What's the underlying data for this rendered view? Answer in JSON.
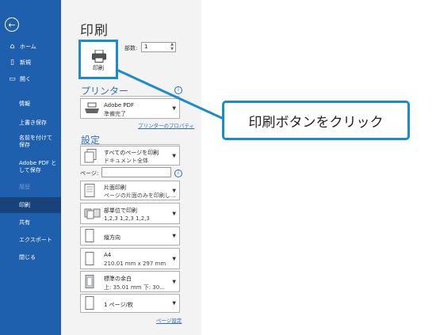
{
  "sidebar": {
    "back_symbol": "←",
    "items": [
      {
        "label": "ホーム",
        "icon": "home-icon"
      },
      {
        "label": "新規",
        "icon": "new-document-icon"
      },
      {
        "label": "開く",
        "icon": "open-folder-icon"
      },
      {
        "label": "情報"
      },
      {
        "label": "上書き保存"
      },
      {
        "label": "名前を付けて保存"
      },
      {
        "label": "Adobe PDF として保存"
      },
      {
        "label": "履歴"
      },
      {
        "label": "印刷"
      },
      {
        "label": "共有"
      },
      {
        "label": "エクスポート"
      },
      {
        "label": "閉じる"
      }
    ]
  },
  "main": {
    "title": "印刷",
    "print_button_label": "印刷",
    "copies_label": "部数:",
    "copies_value": "1",
    "printer_section": {
      "heading": "プリンター",
      "name": "Adobe PDF",
      "status": "準備完了",
      "properties_link": "プリンターのプロパティ"
    },
    "settings_section": {
      "heading": "設定",
      "pages_label": "ページ:",
      "page_setup_link": "ページ設定",
      "dropdowns": [
        {
          "line1": "すべてのページを印刷",
          "line2": "ドキュメント全体"
        },
        {
          "line1": "片面印刷",
          "line2": "ページの片面のみを印刷し..."
        },
        {
          "line1": "部単位で印刷",
          "line2": "1,2,3    1,2,3    1,2,3"
        },
        {
          "line1": "縦方向",
          "line2": ""
        },
        {
          "line1": "A4",
          "line2": "210.01 mm x 297 mm"
        },
        {
          "line1": "標準の余白",
          "line2": "上: 35.01 mm 下: 30..."
        },
        {
          "line1": "1 ページ/枚",
          "line2": ""
        }
      ]
    }
  },
  "callout": {
    "text": "印刷ボタンをクリック"
  },
  "colors": {
    "sidebar": "#1e5fae",
    "sidebar_active": "#17427a",
    "accent": "#1d8bc7",
    "link": "#2f6fb9"
  }
}
